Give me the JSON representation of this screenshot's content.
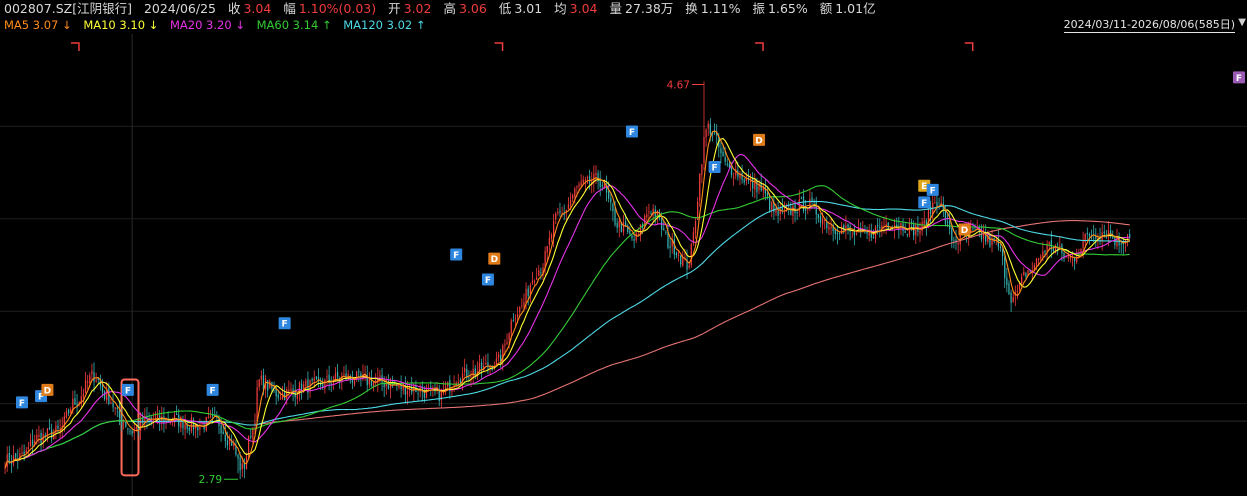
{
  "header": {
    "symbol": "002807.SZ[江阴银行]",
    "date": "2024/06/25",
    "close_label": "收",
    "close_value": "3.04",
    "change_label": "幅",
    "change_value": "1.10%(0.03)",
    "open_label": "开",
    "open_value": "3.02",
    "high_label": "高",
    "high_value": "3.06",
    "low_label": "低",
    "low_value": "3.01",
    "avg_label": "均",
    "avg_value": "3.04",
    "volume_label": "量",
    "volume_value": "27.38万",
    "turnover_label": "换",
    "turnover_value": "1.11%",
    "amplitude_label": "振",
    "amplitude_value": "1.65%",
    "amount_label": "额",
    "amount_value": "1.01亿"
  },
  "ma_legend": [
    {
      "label": "MA5 3.07",
      "arrow": "↓",
      "color": "#ff8c1a"
    },
    {
      "label": "MA10 3.10",
      "arrow": "↓",
      "color": "#ffff33"
    },
    {
      "label": "MA20 3.20",
      "arrow": "↓",
      "color": "#e633e6"
    },
    {
      "label": "MA60 3.14",
      "arrow": "↑",
      "color": "#33cc33"
    },
    {
      "label": "MA120 3.02",
      "arrow": "↑",
      "color": "#4dd9e6"
    }
  ],
  "range_label": "2024/03/11-2026/08/06(585日)",
  "colors": {
    "up": "#f03c3c",
    "down": "#36b3b3",
    "grid": "#1e1e1e",
    "ma5": "#ff8c1a",
    "ma10": "#ffff33",
    "ma20": "#e633e6",
    "ma60": "#33cc33",
    "ma120": "#4dd9e6",
    "ma250": "#e67373",
    "badgeF": "#2e86de",
    "badgeD": "#e07b1a",
    "badgeE": "#e0a61a",
    "badgeF2": "#9b59b6"
  },
  "chart_data": {
    "type": "candlestick",
    "x_start": "2024/03/11",
    "x_end": "2026/08/06",
    "trading_days": 585,
    "ylim": [
      2.7,
      4.85
    ],
    "annotations": [
      {
        "text": "4.67",
        "day": 330,
        "price": 4.67,
        "kind": "high"
      },
      {
        "text": "2.79",
        "day": 110,
        "price": 2.79,
        "kind": "low"
      }
    ],
    "highlight_range": {
      "start_day": 55,
      "end_day": 63
    },
    "price_anchors": [
      [
        0,
        2.85
      ],
      [
        8,
        2.87
      ],
      [
        15,
        2.96
      ],
      [
        25,
        2.99
      ],
      [
        33,
        3.13
      ],
      [
        42,
        3.26
      ],
      [
        48,
        3.16
      ],
      [
        55,
        3.05
      ],
      [
        60,
        2.99
      ],
      [
        66,
        3.04
      ],
      [
        78,
        3.05
      ],
      [
        90,
        3.02
      ],
      [
        100,
        3.04
      ],
      [
        106,
        2.95
      ],
      [
        112,
        2.81
      ],
      [
        117,
        3.01
      ],
      [
        120,
        3.23
      ],
      [
        130,
        3.17
      ],
      [
        145,
        3.21
      ],
      [
        160,
        3.25
      ],
      [
        175,
        3.23
      ],
      [
        190,
        3.2
      ],
      [
        205,
        3.17
      ],
      [
        215,
        3.26
      ],
      [
        222,
        3.28
      ],
      [
        232,
        3.32
      ],
      [
        242,
        3.57
      ],
      [
        252,
        3.77
      ],
      [
        262,
        4.03
      ],
      [
        272,
        4.17
      ],
      [
        280,
        4.2
      ],
      [
        290,
        3.98
      ],
      [
        297,
        3.91
      ],
      [
        305,
        4.06
      ],
      [
        315,
        3.88
      ],
      [
        322,
        3.79
      ],
      [
        332,
        4.45
      ],
      [
        342,
        4.25
      ],
      [
        355,
        4.17
      ],
      [
        365,
        4.03
      ],
      [
        378,
        4.08
      ],
      [
        392,
        3.97
      ],
      [
        405,
        3.93
      ],
      [
        418,
        3.99
      ],
      [
        432,
        3.96
      ],
      [
        440,
        4.1
      ],
      [
        448,
        3.91
      ],
      [
        458,
        3.94
      ],
      [
        468,
        3.89
      ],
      [
        476,
        3.63
      ],
      [
        483,
        3.76
      ],
      [
        493,
        3.88
      ],
      [
        503,
        3.82
      ],
      [
        513,
        3.94
      ],
      [
        520,
        3.95
      ],
      [
        526,
        3.9
      ],
      [
        531,
        3.94
      ]
    ],
    "badges": [
      {
        "text": "F",
        "day": 8,
        "price": 3.13,
        "style": "F"
      },
      {
        "text": "F",
        "day": 17,
        "price": 3.16,
        "style": "F"
      },
      {
        "text": "D",
        "day": 20,
        "price": 3.19,
        "style": "D"
      },
      {
        "text": "F",
        "day": 58,
        "price": 3.19,
        "style": "F"
      },
      {
        "text": "F",
        "day": 98,
        "price": 3.19,
        "style": "F"
      },
      {
        "text": "F",
        "day": 132,
        "price": 3.51,
        "style": "F"
      },
      {
        "text": "F",
        "day": 213,
        "price": 3.84,
        "style": "F"
      },
      {
        "text": "D",
        "day": 231,
        "price": 3.82,
        "style": "D"
      },
      {
        "text": "F",
        "day": 228,
        "price": 3.72,
        "style": "F"
      },
      {
        "text": "F",
        "day": 296,
        "price": 4.43,
        "style": "F"
      },
      {
        "text": "F",
        "day": 335,
        "price": 4.26,
        "style": "F"
      },
      {
        "text": "D",
        "day": 356,
        "price": 4.39,
        "style": "D"
      },
      {
        "text": "E",
        "day": 434,
        "price": 4.17,
        "style": "E"
      },
      {
        "text": "F",
        "day": 438,
        "price": 4.15,
        "style": "F"
      },
      {
        "text": "F",
        "day": 434,
        "price": 4.09,
        "style": "F"
      },
      {
        "text": "D",
        "day": 453,
        "price": 3.96,
        "style": "D"
      },
      {
        "text": "F",
        "day": 584,
        "price": 4.69,
        "style": "F2"
      }
    ],
    "period_marks": [
      {
        "day": 33
      },
      {
        "day": 233
      },
      {
        "day": 356
      },
      {
        "day": 455
      }
    ]
  }
}
